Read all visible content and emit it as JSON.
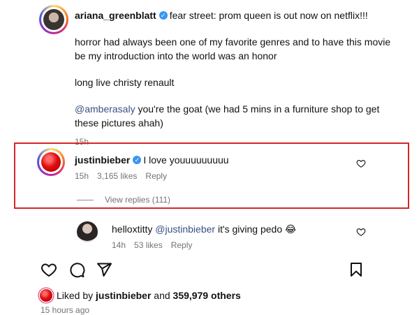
{
  "post": {
    "username": "ariana_greenblatt",
    "caption_first": "fear street: prom queen is out now on netflix!!!",
    "para1": "horror had always been one of my favorite genres and to have this movie be my introduction into the world was an honor",
    "para2": "long live christy renault",
    "mention": "@amberasaly",
    "para3_rest": " you're the goat (we had 5 mins in a furniture shop to get these pictures ahah)",
    "time": "15h"
  },
  "comment1": {
    "username": "justinbieber",
    "text": "I love youuuuuuuuu",
    "time": "15h",
    "likes": "3,165 likes",
    "reply": "Reply",
    "view_replies": "View replies (111)"
  },
  "comment2": {
    "username": "helloxtitty",
    "mention": "@justinbieber",
    "text": " it's giving pedo 😂",
    "time": "14h",
    "likes": "53 likes",
    "reply": "Reply"
  },
  "footer": {
    "liked_prefix": "Liked by ",
    "liked_user": "justinbieber",
    "liked_and": " and ",
    "liked_count": "359,979 others",
    "post_time": "15 hours ago"
  },
  "icons": [
    "heart-icon",
    "comment-icon",
    "share-icon",
    "bookmark-icon",
    "verified-badge-icon"
  ],
  "colors": {
    "highlight": "#d62728",
    "verified": "#3897f0",
    "mention": "#385185",
    "meta": "#737373"
  }
}
